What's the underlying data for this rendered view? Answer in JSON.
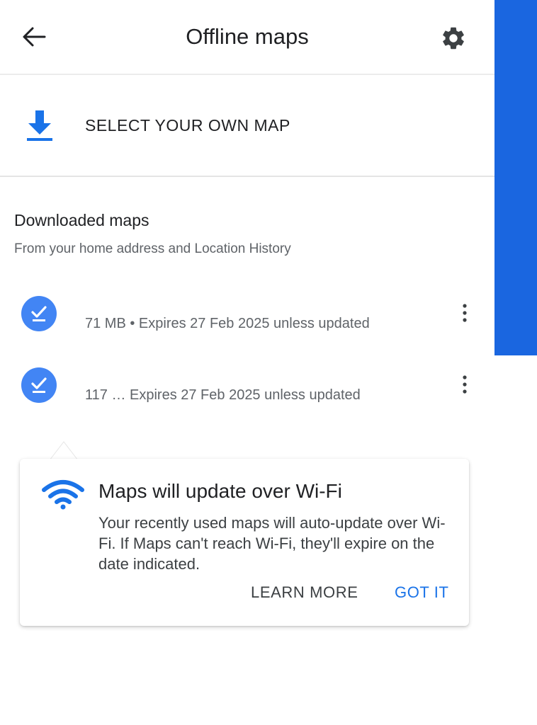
{
  "header": {
    "title": "Offline maps",
    "back_icon": "arrow-back-icon",
    "settings_icon": "gear-icon"
  },
  "select_map": {
    "label": "SELECT YOUR OWN MAP",
    "icon": "download-icon"
  },
  "downloaded": {
    "title": "Downloaded maps",
    "subtitle": "From your home address and Location History",
    "items": [
      {
        "name": "",
        "meta": "71 MB • Expires 27 Feb 2025 unless updated"
      },
      {
        "name": "",
        "meta": "117 … Expires 27 Feb 2025 unless updated"
      }
    ]
  },
  "tooltip": {
    "title": "Maps will update over Wi-Fi",
    "body": "Your recently used maps will auto-update over Wi-Fi. If Maps can't reach Wi-Fi, they'll expire on the date indicated.",
    "learn_more": "LEARN MORE",
    "got_it": "GOT IT"
  },
  "colors": {
    "accent": "#4285f4",
    "link": "#1a73e8",
    "edge_strip": "#1a66e0"
  }
}
